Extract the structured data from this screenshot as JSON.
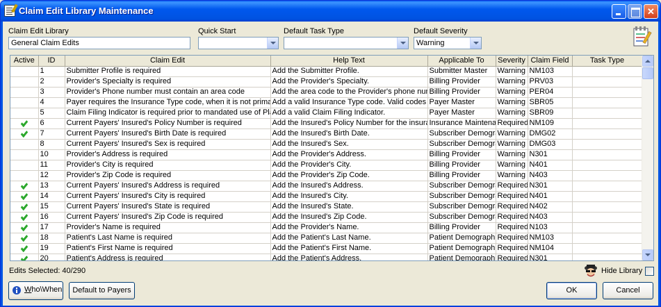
{
  "window": {
    "title": "Claim Edit Library Maintenance"
  },
  "filters": {
    "library_label": "Claim Edit Library",
    "library_value": "General Claim Edits",
    "quick_start_label": "Quick Start",
    "quick_start_value": "",
    "default_task_type_label": "Default Task Type",
    "default_task_type_value": "",
    "default_severity_label": "Default Severity",
    "default_severity_value": "Warning"
  },
  "grid": {
    "columns": [
      "Active",
      "ID",
      "Claim Edit",
      "Help Text",
      "Applicable To",
      "Severity",
      "Claim Field",
      "Task Type"
    ],
    "rows": [
      {
        "active": false,
        "id": "1",
        "edit": "Submitter Profile is required",
        "help": "Add the Submitter Profile.",
        "applies": "Submitter Master",
        "severity": "Warning",
        "field": "NM103",
        "task": ""
      },
      {
        "active": false,
        "id": "2",
        "edit": "Provider's Specialty is required",
        "help": "Add the Provider's Specialty.",
        "applies": "Billing Provider",
        "severity": "Warning",
        "field": "PRV03",
        "task": ""
      },
      {
        "active": false,
        "id": "3",
        "edit": "Provider's Phone number must contain an area code",
        "help": "Add the area code to the Provider's phone number.",
        "applies": "Billing Provider",
        "severity": "Warning",
        "field": "PER04",
        "task": ""
      },
      {
        "active": false,
        "id": "4",
        "edit": "Payer requires the Insurance Type code, when it is not primary",
        "help": "Add a valid Insurance Type code. Valid codes",
        "applies": "Payer Master",
        "severity": "Warning",
        "field": "SBR05",
        "task": ""
      },
      {
        "active": false,
        "id": "5",
        "edit": "Claim Filing Indicator is required prior to mandated use of Plan",
        "help": "Add a valid Claim Filing Indicator.",
        "applies": "Payer Master",
        "severity": "Warning",
        "field": "SBR09",
        "task": ""
      },
      {
        "active": true,
        "id": "6",
        "edit": "Current Payers' Insured's Policy Number is required",
        "help": "Add the Insured's Policy Number for the insurance",
        "applies": "Insurance Maintenance",
        "severity": "Required",
        "field": "NM109",
        "task": ""
      },
      {
        "active": true,
        "id": "7",
        "edit": "Current Payers' Insured's Birth Date is required",
        "help": "Add the Insured's Birth Date.",
        "applies": "Subscriber Demographics",
        "severity": "Warning",
        "field": "DMG02",
        "task": ""
      },
      {
        "active": false,
        "id": "8",
        "edit": "Current Payers' Insured's Sex is required",
        "help": "Add the Insured's Sex.",
        "applies": "Subscriber Demographics",
        "severity": "Warning",
        "field": "DMG03",
        "task": ""
      },
      {
        "active": false,
        "id": "10",
        "edit": "Provider's Address is required",
        "help": "Add the Provider's Address.",
        "applies": "Billing Provider",
        "severity": "Warning",
        "field": "N301",
        "task": ""
      },
      {
        "active": false,
        "id": "11",
        "edit": "Provider's City is required",
        "help": "Add the Provider's City.",
        "applies": "Billing Provider",
        "severity": "Warning",
        "field": "N401",
        "task": ""
      },
      {
        "active": false,
        "id": "12",
        "edit": "Provider's Zip Code is required",
        "help": "Add the Provider's Zip Code.",
        "applies": "Billing Provider",
        "severity": "Warning",
        "field": "N403",
        "task": ""
      },
      {
        "active": true,
        "id": "13",
        "edit": "Current Payers' Insured's Address is required",
        "help": "Add the Insured's Address.",
        "applies": "Subscriber Demographics",
        "severity": "Required",
        "field": "N301",
        "task": ""
      },
      {
        "active": true,
        "id": "14",
        "edit": "Current Payers' Insured's City is required",
        "help": "Add the Insured's City.",
        "applies": "Subscriber Demographics",
        "severity": "Required",
        "field": "N401",
        "task": ""
      },
      {
        "active": true,
        "id": "15",
        "edit": "Current Payers' Insured's State is required",
        "help": "Add the Insured's State.",
        "applies": "Subscriber Demographics",
        "severity": "Required",
        "field": "N402",
        "task": ""
      },
      {
        "active": true,
        "id": "16",
        "edit": "Current Payers' Insured's Zip Code is required",
        "help": "Add the Insured's Zip Code.",
        "applies": "Subscriber Demographics",
        "severity": "Required",
        "field": "N403",
        "task": ""
      },
      {
        "active": true,
        "id": "17",
        "edit": "Provider's Name is required",
        "help": "Add the Provider's Name.",
        "applies": "Billing Provider",
        "severity": "Required",
        "field": "N103",
        "task": ""
      },
      {
        "active": true,
        "id": "18",
        "edit": "Patient's Last Name is required",
        "help": "Add the Patient's Last Name.",
        "applies": "Patient Demographics",
        "severity": "Required",
        "field": "NM103",
        "task": ""
      },
      {
        "active": true,
        "id": "19",
        "edit": "Patient's First Name is required",
        "help": "Add the Patient's First Name.",
        "applies": "Patient Demographics",
        "severity": "Required",
        "field": "NM104",
        "task": ""
      },
      {
        "active": true,
        "id": "20",
        "edit": "Patient's Address is required",
        "help": "Add the Patient's Address.",
        "applies": "Patient Demographics",
        "severity": "Required",
        "field": "N301",
        "task": ""
      }
    ]
  },
  "footer": {
    "edits_selected": "Edits Selected: 40/290",
    "hide_library_label": "Hide Library",
    "who_when_prefix": "W",
    "who_when_rest": "ho\\When",
    "default_to_payers_label": "Default to Payers",
    "ok_label": "OK",
    "cancel_label": "Cancel"
  },
  "icons": {
    "app": "notepad-icon",
    "notes": "notes-icon",
    "hide_library": "spy-icon",
    "who_when": "info-icon"
  }
}
